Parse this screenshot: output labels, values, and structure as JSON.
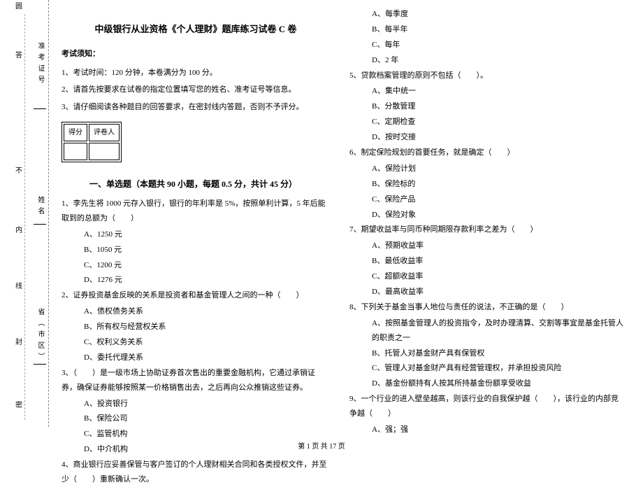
{
  "sidebar": {
    "top_char": "圆",
    "admit_label": "准考证号",
    "name_label": "姓名",
    "province_label": "省（市区）",
    "guide_top": "答",
    "guide_nofold": "不",
    "guide_inside": "内",
    "guide_line": "线",
    "guide_seal": "封",
    "guide_密": "密"
  },
  "title": "中级银行从业资格《个人理财》题库练习试卷 C 卷",
  "notice": {
    "head": "考试须知：",
    "line1": "1、考试时间：120 分钟，本卷满分为 100 分。",
    "line2": "2、请首先按要求在试卷的指定位置填写您的姓名、准考证号等信息。",
    "line3": "3、请仔细阅读各种题目的回答要求，在密封线内答题，否则不予评分。"
  },
  "score": {
    "c1": "得分",
    "c2": "评卷人"
  },
  "section1": "一、单选题（本题共 90 小题，每题 0.5 分，共计 45 分）",
  "q1": {
    "stem": "1、李先生将 1000 元存入银行，银行的年利率是 5%，按照单利计算，5 年后能取到的总额为（　　）",
    "a": "A、1250 元",
    "b": "B、1050 元",
    "c": "C、1200 元",
    "d": "D、1276 元"
  },
  "q2": {
    "stem": "2、证券投资基金反映的关系是投资者和基金管理人之间的一种（　　）",
    "a": "A、债权债务关系",
    "b": "B、所有权与经营权关系",
    "c": "C、权利义务关系",
    "d": "D、委托代理关系"
  },
  "q3": {
    "stem": "3、（　　）是一级市场上协助证券首次售出的重要金融机构，它通过承销证券，确保证券能够按照某一价格销售出去，之后再向公众推销这些证券。",
    "a": "A、投资银行",
    "b": "B、保险公司",
    "c": "C、监管机构",
    "d": "D、中介机构"
  },
  "q4": {
    "stem": "4、商业银行应妥善保管与客户签订的个人理财相关合同和各类授权文件，并至少（　　）重新确认一次。"
  },
  "r_opts_q4": {
    "a": "A、每季度",
    "b": "B、每半年",
    "c": "C、每年",
    "d": "D、2 年"
  },
  "q5": {
    "stem": "5、贷款档案管理的原则不包括（　　）。",
    "a": "A、集中统一",
    "b": "B、分散管理",
    "c": "C、定期检查",
    "d": "D、按时交接"
  },
  "q6": {
    "stem": "6、制定保险规划的首要任务，就是确定（　　）",
    "a": "A、保险计划",
    "b": "B、保险标的",
    "c": "C、保险产品",
    "d": "D、保险对象"
  },
  "q7": {
    "stem": "7、期望收益率与同币种同期限存款利率之差为（　　）",
    "a": "A、预期收益率",
    "b": "B、最低收益率",
    "c": "C、超额收益率",
    "d": "D、最高收益率"
  },
  "q8": {
    "stem": "8、下列关于基金当事人地位与责任的说法，不正确的是（　　）",
    "a": "A、按照基金管理人的投资指令，及时办理清算、交割等事宜是基金托管人的职责之一",
    "b": "B、托管人对基金财产具有保管权",
    "c": "C、管理人对基金财产具有经营管理权，并承担投资风险",
    "d": "D、基金份额持有人按其所持基金份额享受收益"
  },
  "q9": {
    "stem": "9、一个行业的进入壁垒越高，则该行业的自我保护越（　　），该行业的内部竞争越（　　）",
    "a": "A、强；强"
  },
  "footer": "第 1 页 共 17 页"
}
